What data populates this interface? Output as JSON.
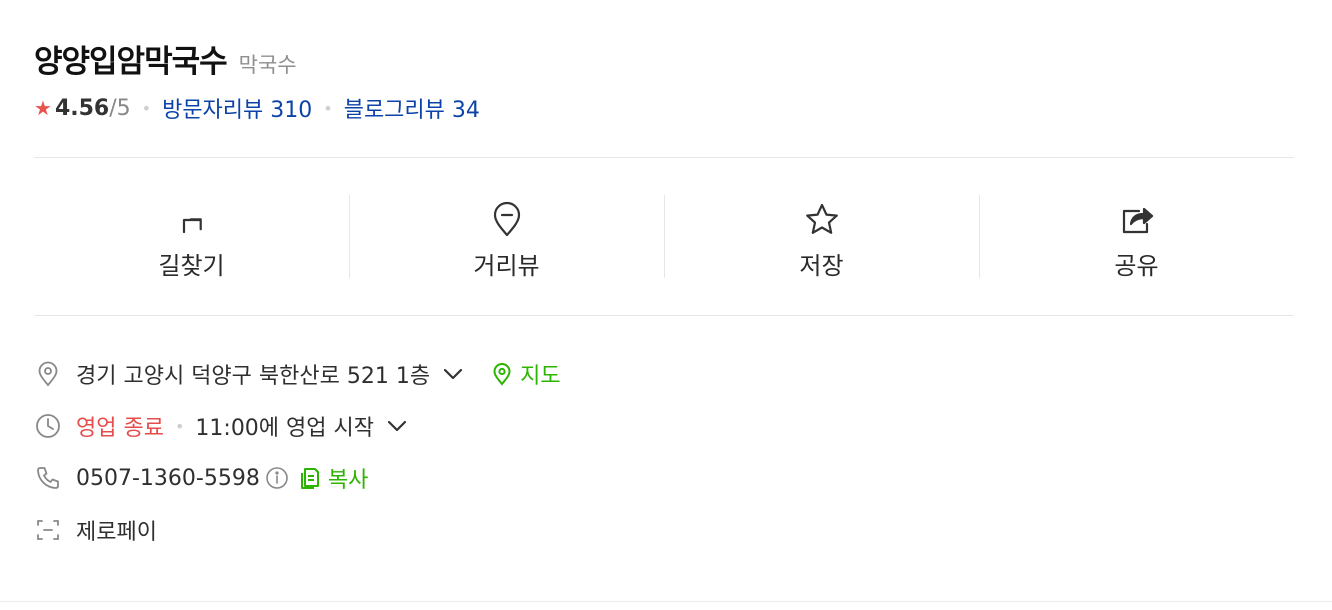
{
  "place": {
    "name": "양양입암막국수",
    "category": "막국수"
  },
  "rating": {
    "score": "4.56",
    "max": "/5",
    "visitor_review": "방문자리뷰 310",
    "blog_review": "블로그리뷰 34"
  },
  "actions": [
    {
      "label": "길찾기",
      "icon": "directions-icon"
    },
    {
      "label": "거리뷰",
      "icon": "street-view-icon"
    },
    {
      "label": "저장",
      "icon": "star-outline-icon"
    },
    {
      "label": "공유",
      "icon": "share-icon"
    }
  ],
  "info": {
    "address": "경기 고양시 덕양구 북한산로 521 1층",
    "map_label": "지도",
    "status": "영업 종료",
    "hours": "11:00에 영업 시작",
    "phone": "0507-1360-5598",
    "copy_label": "복사",
    "pay": "제로페이"
  },
  "colors": {
    "accent_green": "#2db400",
    "closed_red": "#e54d4d",
    "link_blue": "#0d43a8",
    "star_red": "#e8544d"
  }
}
